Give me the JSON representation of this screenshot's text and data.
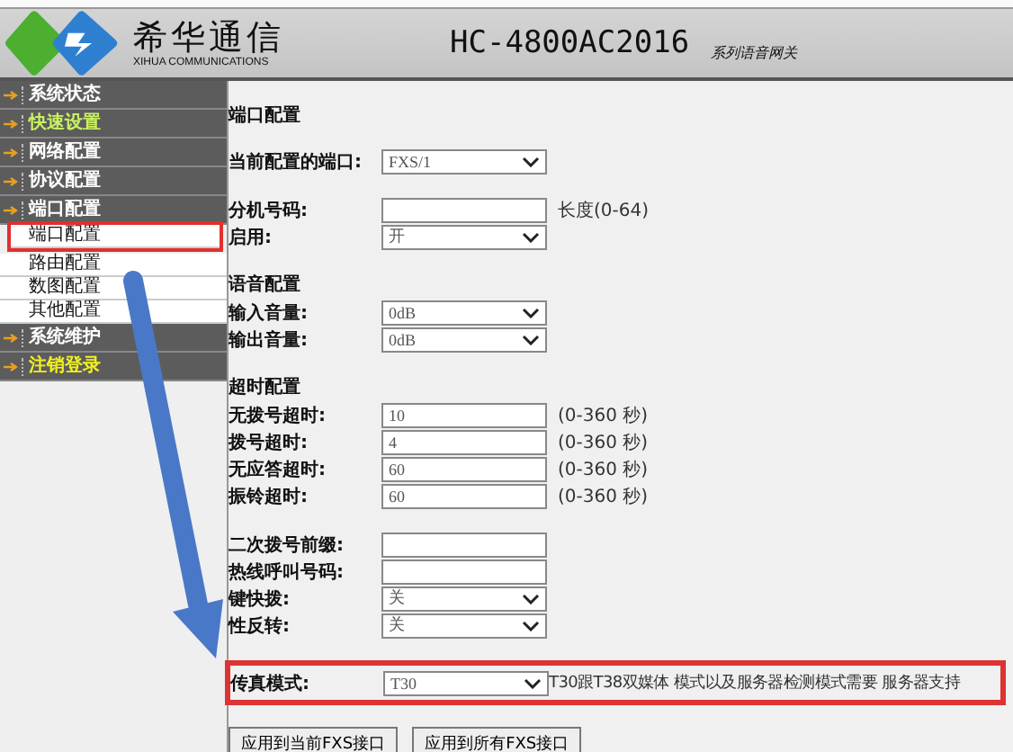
{
  "header": {
    "brand": "希华通信",
    "brand_sub": "XIHUA COMMUNICATIONS",
    "model": "HC-4800AC2016",
    "model_sub": "系列语音网关"
  },
  "sidebar": {
    "items": [
      {
        "label": "系统状态",
        "kind": "normal"
      },
      {
        "label": "快速设置",
        "kind": "shortcut"
      },
      {
        "label": "网络配置",
        "kind": "normal"
      },
      {
        "label": "协议配置",
        "kind": "normal"
      },
      {
        "label": "端口配置",
        "kind": "normal",
        "children": [
          {
            "label": "端口配置",
            "annotated": true
          },
          {
            "label": "路由配置",
            "annotated": false
          },
          {
            "label": "数图配置",
            "annotated": false
          },
          {
            "label": "其他配置",
            "annotated": false
          }
        ]
      },
      {
        "label": "系统维护",
        "kind": "normal"
      },
      {
        "label": "注销登录",
        "kind": "logout"
      }
    ]
  },
  "form": {
    "sections": [
      {
        "heading": "端口配置",
        "annotated": false,
        "fields": [
          {
            "label": "当前配置的端口:",
            "kind": "select",
            "value": "FXS/1"
          }
        ]
      },
      {
        "annotated": false,
        "fields": [
          {
            "label": "分机号码:",
            "kind": "input",
            "hint": "长度(0-64)"
          },
          {
            "label": "启用:",
            "kind": "select",
            "value": "开"
          }
        ]
      },
      {
        "heading": "语音配置",
        "annotated": false,
        "fields": [
          {
            "label": "输入音量:",
            "kind": "select",
            "value": "0dB"
          },
          {
            "label": "输出音量:",
            "kind": "select",
            "value": "0dB"
          }
        ]
      },
      {
        "heading": "超时配置",
        "annotated": false,
        "fields": [
          {
            "label": "无拨号超时:",
            "kind": "input",
            "value": "10",
            "hint": "(0-360 秒)"
          },
          {
            "label": "拨号超时:",
            "kind": "input",
            "value": "4",
            "hint": "(0-360 秒)"
          },
          {
            "label": "无应答超时:",
            "kind": "input",
            "value": "60",
            "hint": "(0-360 秒)"
          },
          {
            "label": "振铃超时:",
            "kind": "input",
            "value": "60",
            "hint": "(0-360 秒)"
          }
        ]
      },
      {
        "annotated": false,
        "fields": [
          {
            "label": "二次拨号前缀:",
            "kind": "input"
          },
          {
            "label": "热线呼叫号码:",
            "kind": "input"
          },
          {
            "label": "键快拨:",
            "kind": "select",
            "value": "关"
          },
          {
            "label": "性反转:",
            "kind": "select",
            "value": "关"
          }
        ]
      },
      {
        "annotated": true,
        "fields": [
          {
            "label": "传真模式:",
            "kind": "select",
            "value": "T30",
            "hint": "T30跟T38双媒体 模式以及服务器检测模式需要 服务器支持"
          }
        ]
      }
    ]
  },
  "buttons": [
    "应用到当前FXS接口",
    "应用到所有FXS接口"
  ]
}
